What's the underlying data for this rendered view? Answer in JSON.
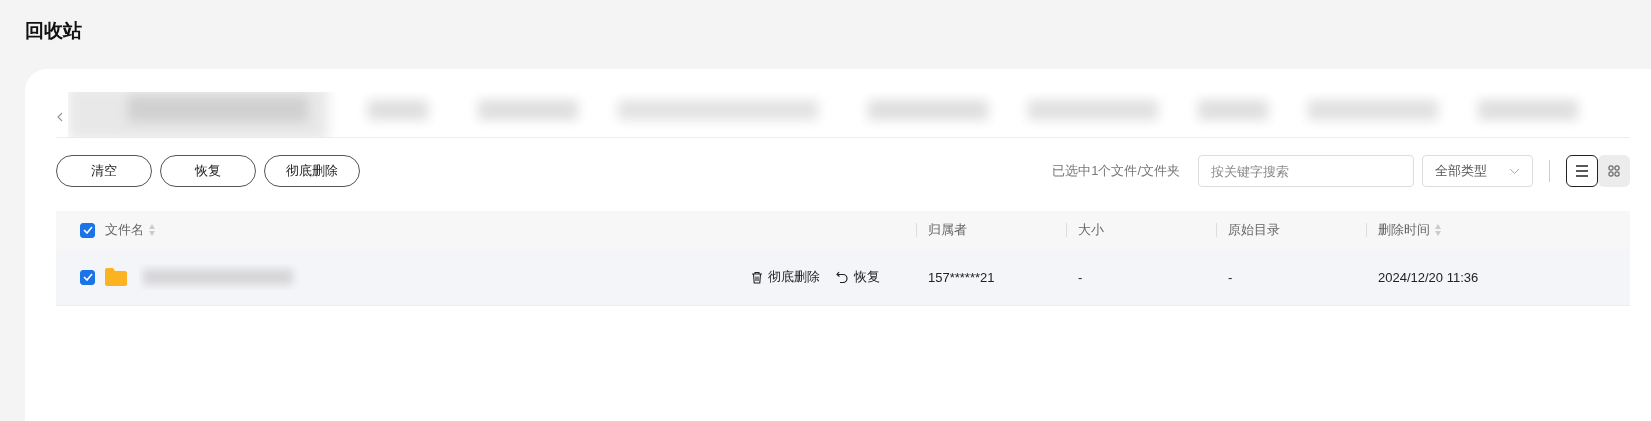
{
  "page_title": "回收站",
  "toolbar": {
    "buttons": [
      "清空",
      "恢复",
      "彻底删除"
    ],
    "selection_info": "已选中1个文件/文件夹",
    "search": {
      "placeholder": "按关键字搜索"
    },
    "type_filter": {
      "value": "全部类型"
    },
    "views": [
      {
        "kind": "list",
        "selected": true
      },
      {
        "kind": "grid",
        "selected": false
      }
    ]
  },
  "table": {
    "all_checked": true,
    "columns": [
      {
        "label": "文件名",
        "sortable": true
      },
      {
        "label": "归属者",
        "sortable": false
      },
      {
        "label": "大小",
        "sortable": false
      },
      {
        "label": "原始目录",
        "sortable": false
      },
      {
        "label": "删除时间",
        "sortable": true
      }
    ],
    "rows": [
      {
        "checked": true,
        "actions": [
          {
            "kind": "delete",
            "label": "彻底删除"
          },
          {
            "kind": "restore",
            "label": "恢复"
          }
        ],
        "owner": "157******21",
        "size": "-",
        "directory": "-",
        "deleted_at": "2024/12/20 11:36"
      }
    ]
  }
}
